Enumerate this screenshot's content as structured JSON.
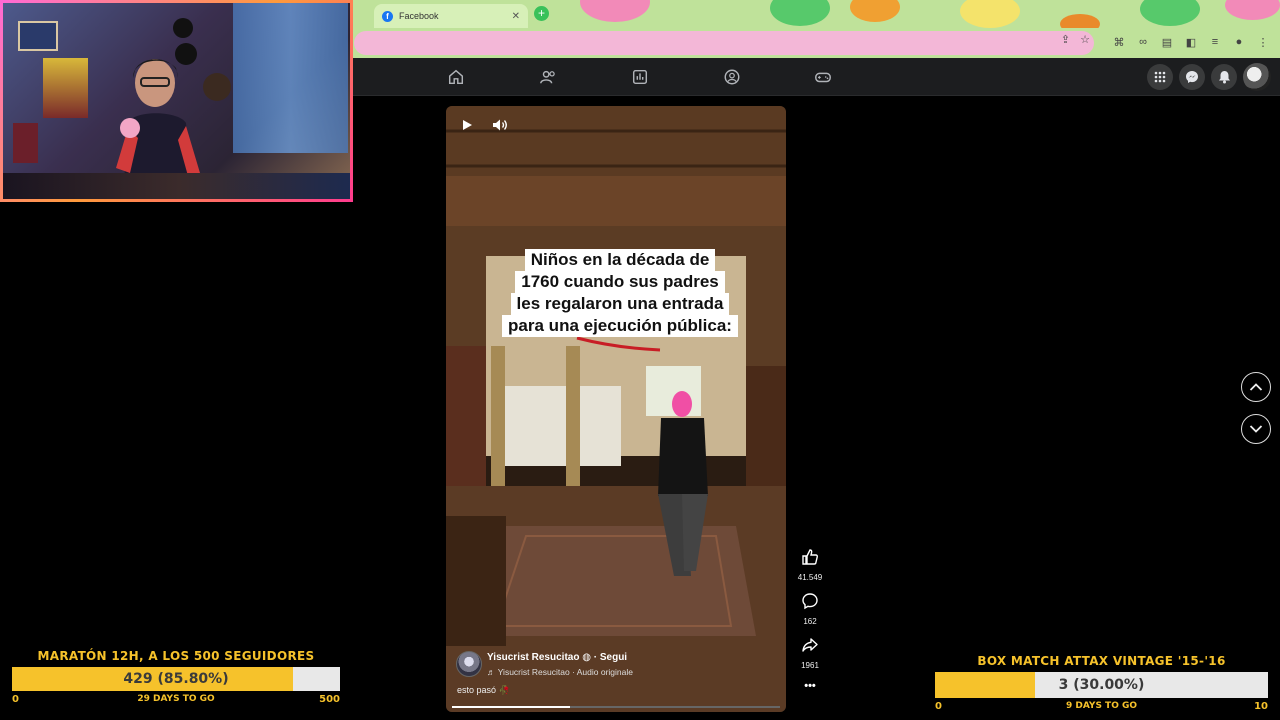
{
  "browser": {
    "tab_title": "Facebook",
    "tab_favicon": "facebook-icon",
    "omnibox_color": "#f3b7d7"
  },
  "facebook_nav": {
    "items": [
      "home-icon",
      "friends-icon",
      "dashboard-icon",
      "groups-icon",
      "gaming-icon"
    ],
    "right": [
      "menu-grid-icon",
      "messenger-icon",
      "notifications-icon",
      "profile-avatar"
    ]
  },
  "reel": {
    "caption_lines": [
      "Niños en la década de",
      "1760 cuando sus padres",
      "les regalaron una entrada",
      "para una ejecución pública:"
    ],
    "creator_name": "Yisucrist Resucitao",
    "follow_label": "· Segui",
    "audio_label": "♬ Yisucrist Resucitao · Audio originale",
    "description": "esto pasó 🥀",
    "progress": 0.36,
    "likes": "41.549",
    "comments": "162",
    "shares": "1961",
    "more": "•••"
  },
  "goals": {
    "left": {
      "title": "MARATÓN 12H, A LOS 500 SEGUIDORES",
      "bar_text": "429 (85.80%)",
      "fraction": 0.858,
      "min": "0",
      "days": "29 DAYS TO GO",
      "max": "500"
    },
    "right": {
      "title": "BOX MATCH ATTAX VINTAGE '15-'16",
      "bar_text": "3 (30.00%)",
      "fraction": 0.3,
      "min": "0",
      "days": "9 DAYS TO GO",
      "max": "10"
    }
  },
  "colors": {
    "goal_yellow": "#f6c22b",
    "tabstrip": "#bfe29a",
    "facebook_blue": "#1877f2"
  }
}
